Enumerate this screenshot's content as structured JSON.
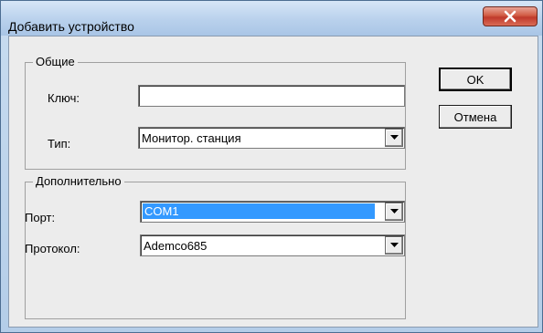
{
  "window": {
    "title": "Добавить устройство"
  },
  "groups": {
    "general": {
      "legend": "Общие",
      "key_label": "Ключ:",
      "key_value": "",
      "type_label": "Тип:",
      "type_value": "Монитор. станция"
    },
    "extra": {
      "legend": "Дополнительно",
      "port_label": "Порт:",
      "port_value": "COM1",
      "protocol_label": "Протокол:",
      "protocol_value": "Ademco685"
    }
  },
  "buttons": {
    "ok": "OK",
    "cancel": "Отмена"
  },
  "icons": {
    "close": "close-icon",
    "dropdown": "chevron-down-icon"
  },
  "colors": {
    "selection": "#3399ff",
    "close_button": "#c0392b"
  }
}
